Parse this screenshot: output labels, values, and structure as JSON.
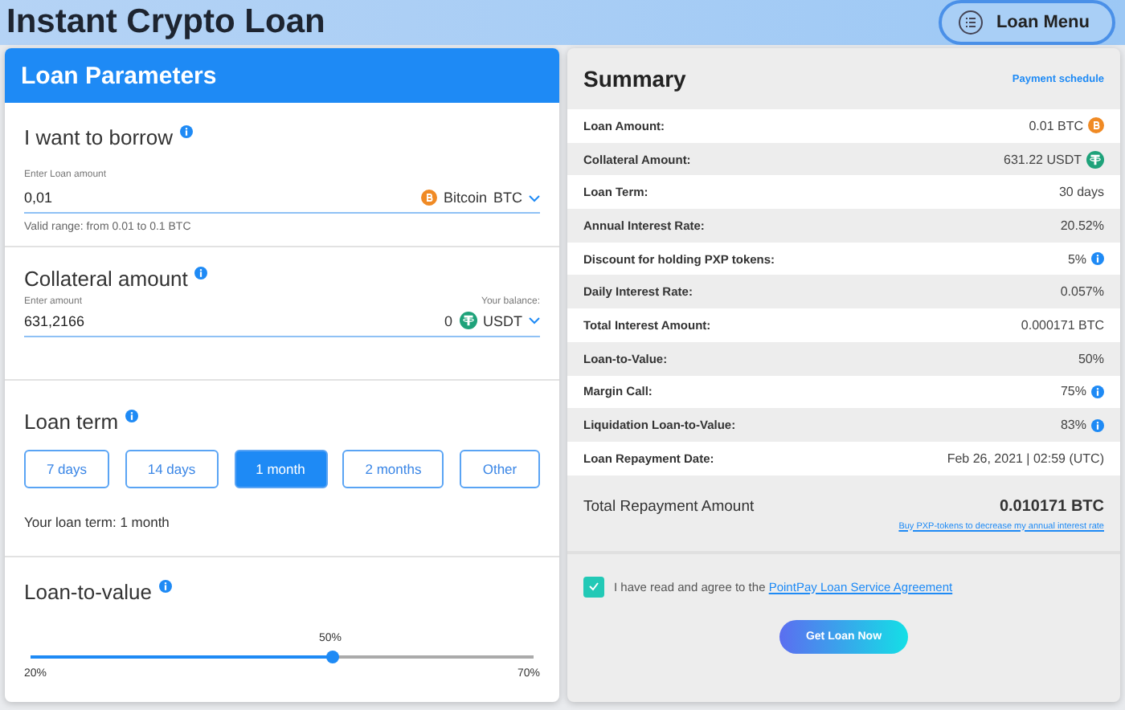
{
  "header": {
    "title": "Instant Crypto Loan",
    "menu_button": "Loan Menu"
  },
  "parameters": {
    "title": "Loan Parameters",
    "borrow": {
      "label": "I want to borrow",
      "field_label": "Enter Loan amount",
      "value": "0,01",
      "currency_name": "Bitcoin",
      "currency_code": "BTC",
      "hint": "Valid range: from 0.01 to 0.1 BTC"
    },
    "collateral": {
      "label": "Collateral amount",
      "field_label": "Enter amount",
      "value": "631,2166",
      "balance_label": "Your balance:",
      "balance": "0",
      "currency_code": "USDT"
    },
    "term": {
      "label": "Loan term",
      "options": [
        {
          "label": "7 days",
          "selected": false
        },
        {
          "label": "14 days",
          "selected": false
        },
        {
          "label": "1 month",
          "selected": true
        },
        {
          "label": "2 months",
          "selected": false
        },
        {
          "label": "Other",
          "selected": false
        }
      ],
      "summary": "Your loan term: 1 month"
    },
    "ltv": {
      "label": "Loan-to-value",
      "reading": "50%",
      "min": "20%",
      "max": "70%",
      "level": 0.6
    }
  },
  "summary": {
    "title": "Summary",
    "link": "Payment schedule",
    "rows": [
      {
        "label": "Loan Amount:",
        "value": "0.01 BTC",
        "kind": "btc"
      },
      {
        "label": "Collateral Amount:",
        "value": "631.22 USDT",
        "kind": "usdt"
      },
      {
        "label": "Loan Term:",
        "value": "30 days",
        "kind": "plain"
      },
      {
        "label": "Annual Interest Rate:",
        "value": "20.52%",
        "kind": "plain"
      },
      {
        "label": "Discount for holding PXP tokens:",
        "value": "5%",
        "kind": "info"
      },
      {
        "label": "Daily Interest Rate:",
        "value": "0.057%",
        "kind": "plain"
      },
      {
        "label": "Total Interest Amount:",
        "value": "0.000171 BTC",
        "kind": "plain"
      },
      {
        "label": "Loan-to-Value:",
        "value": "50%",
        "kind": "plain"
      },
      {
        "label": "Margin Call:",
        "value": "75%",
        "kind": "info"
      },
      {
        "label": "Liquidation Loan-to-Value:",
        "value": "83%",
        "kind": "info"
      },
      {
        "label": "Loan Repayment Date:",
        "value": "Feb 26, 2021 | 02:59 (UTC)",
        "kind": "plain"
      }
    ],
    "total_label": "Total Repayment Amount",
    "total_value": "0.010171 BTC",
    "buy_link": "Buy PXP-tokens to decrease my annual interest rate",
    "agreement": {
      "text": "I have read and agree to the",
      "link": "PointPay Loan Service Agreement",
      "checked": true
    },
    "submit": "Get Loan Now"
  }
}
